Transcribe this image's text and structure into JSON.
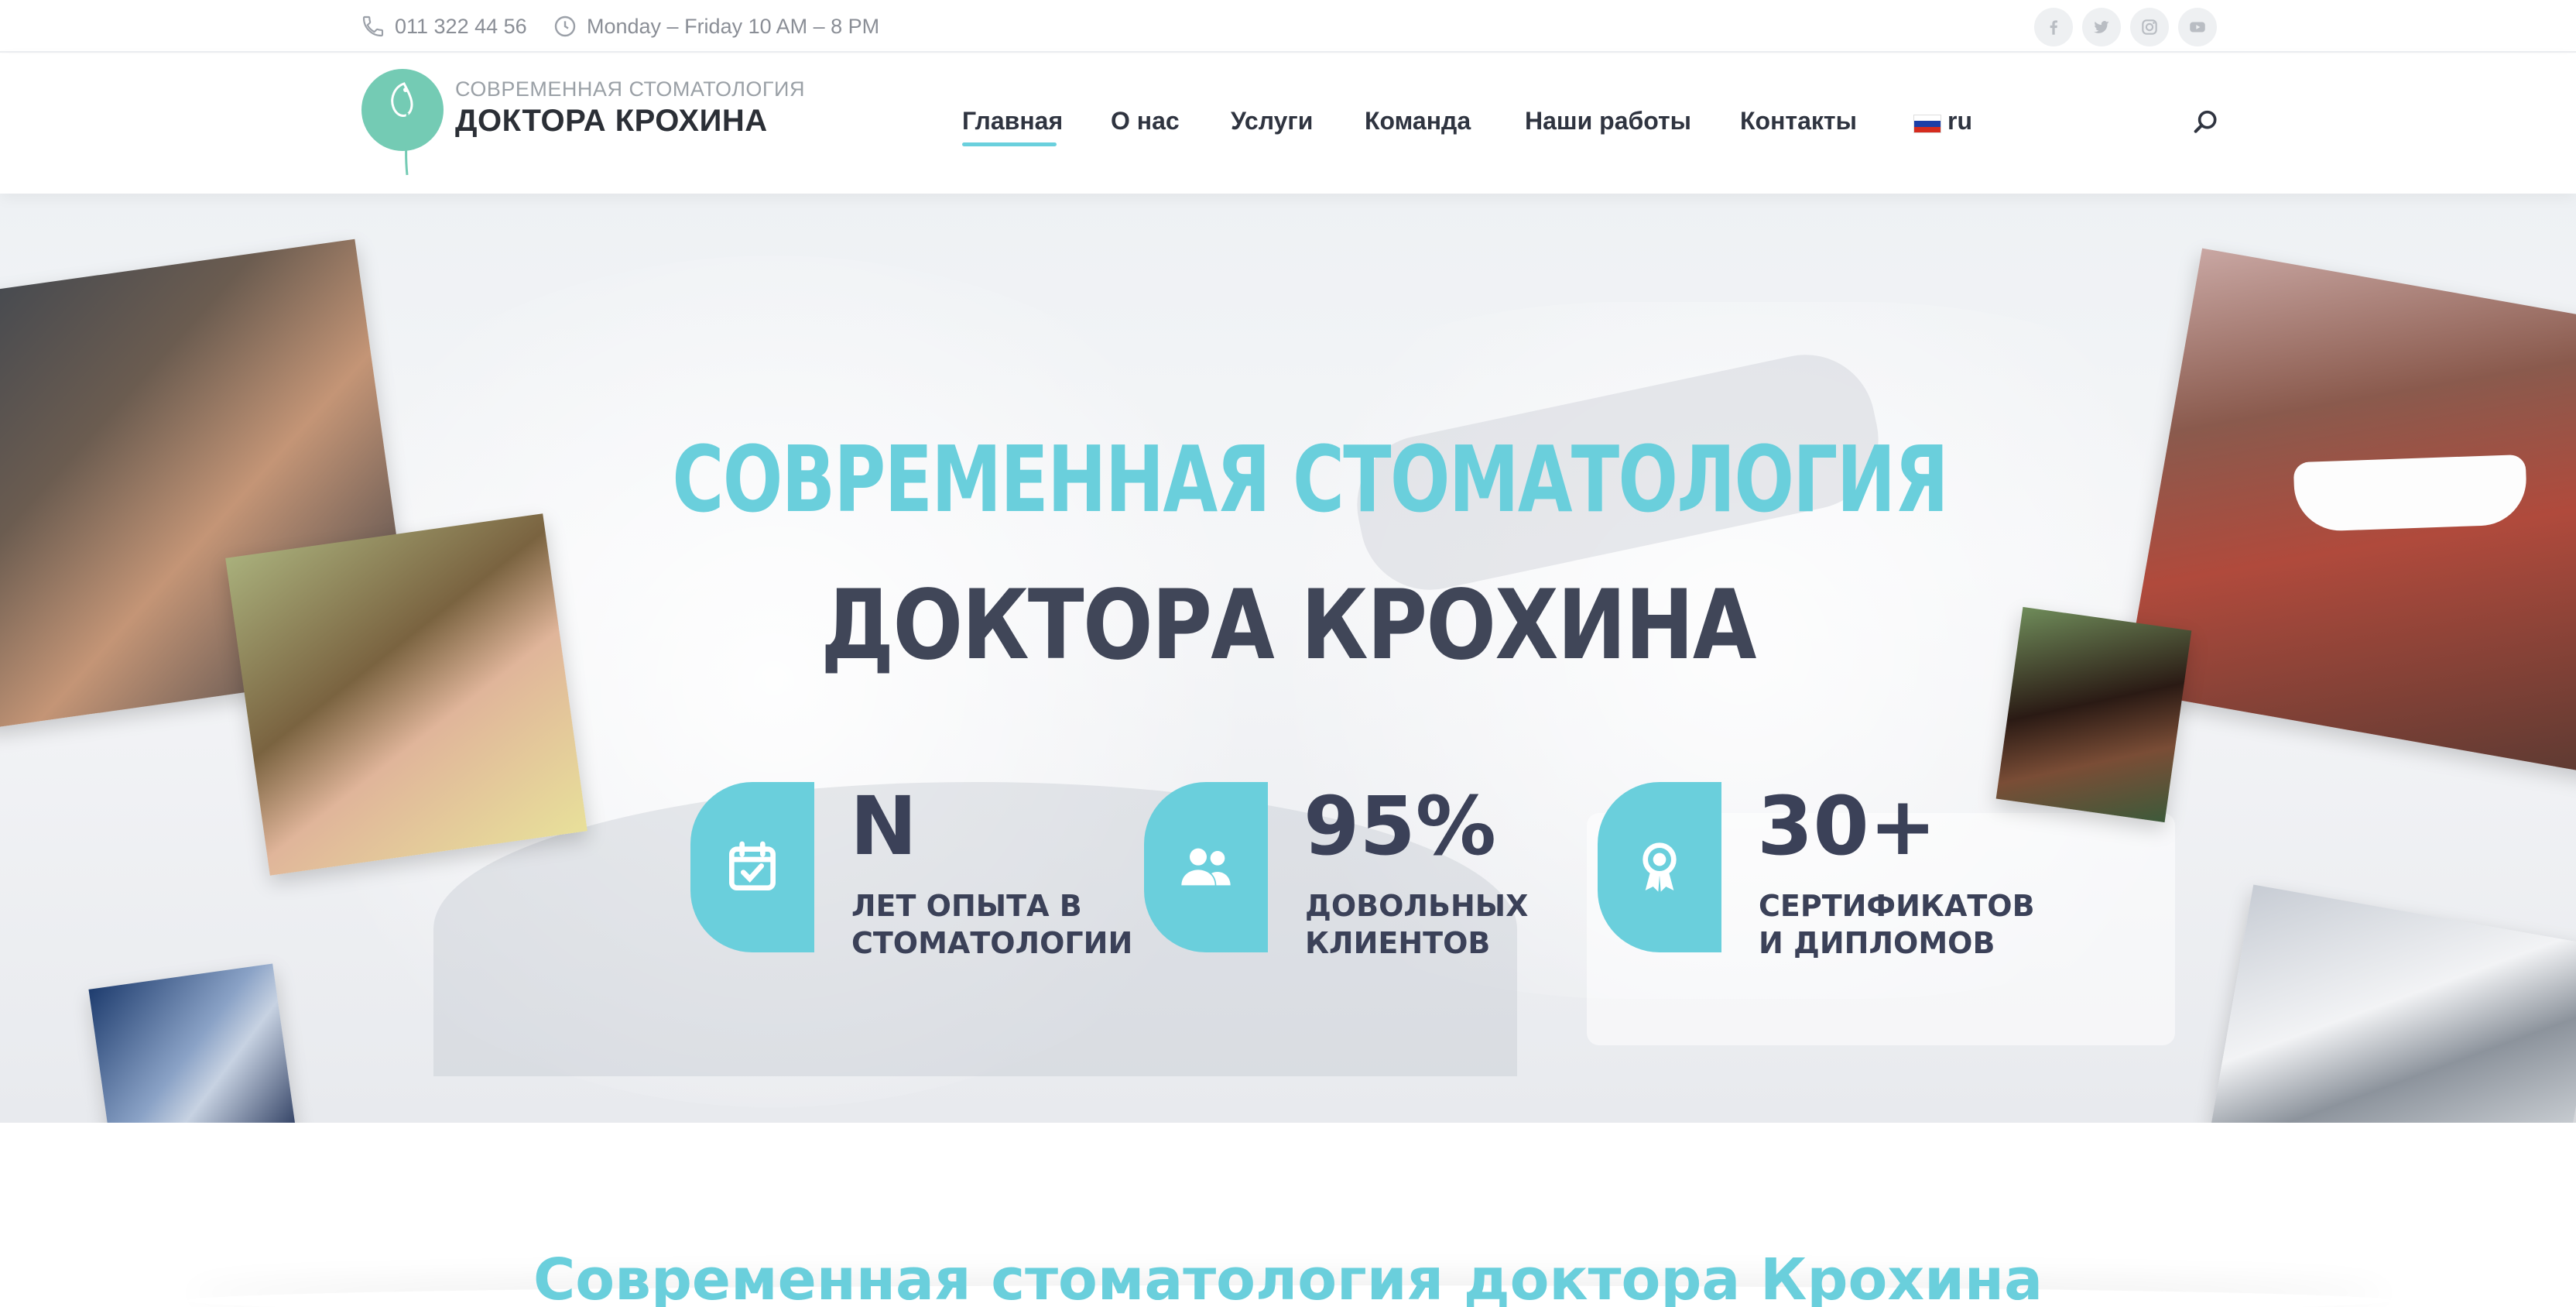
{
  "topbar": {
    "phone": "011 322 44 56",
    "hours": "Monday – Friday 10 AM – 8 PM",
    "social": [
      "facebook-icon",
      "twitter-icon",
      "instagram-icon",
      "youtube-icon"
    ]
  },
  "header": {
    "logo_small": "СОВРЕМЕННАЯ СТОМАТОЛОГИЯ",
    "logo_big": "ДОКТОРА КРОХИНА",
    "nav": [
      {
        "label": "Главная",
        "active": true
      },
      {
        "label": "О нас"
      },
      {
        "label": "Услуги"
      },
      {
        "label": "Команда"
      },
      {
        "label": "Наши работы"
      },
      {
        "label": "Контакты"
      }
    ],
    "language": "ru"
  },
  "hero": {
    "title_line1": "СОВРЕМЕННАЯ СТОМАТОЛОГИЯ",
    "title_line2": "ДОКТОРА КРОХИНА",
    "stats": [
      {
        "icon": "calendar-check-icon",
        "value": "N",
        "label_line1": "ЛЕТ ОПЫТА В",
        "label_line2": "СТОМАТОЛОГИИ"
      },
      {
        "icon": "users-icon",
        "value": "95%",
        "label_line1": "ДОВОЛЬНЫХ",
        "label_line2": "КЛИЕНТОВ"
      },
      {
        "icon": "award-icon",
        "value": "30+",
        "label_line1": "СЕРТИФИКАТОВ",
        "label_line2": "И ДИПЛОМОВ"
      }
    ]
  },
  "section": {
    "title": "Современная стоматология доктора Крохина"
  },
  "colors": {
    "accent": "#6acfdc",
    "dark": "#404658"
  }
}
